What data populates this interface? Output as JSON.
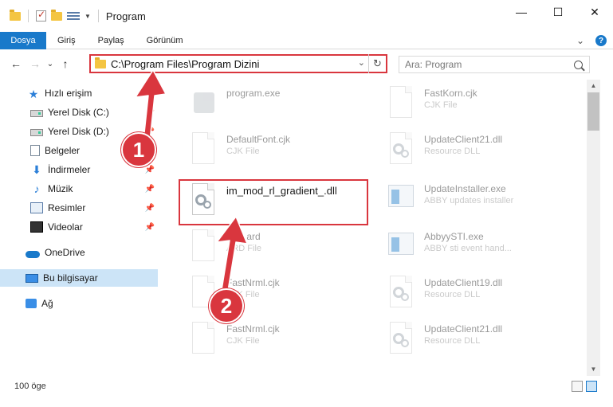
{
  "window": {
    "title": "Program",
    "minimize": "—",
    "maximize": "☐",
    "close": "✕"
  },
  "ribbon": {
    "tabs": [
      "Dosya",
      "Giriş",
      "Paylaş",
      "Görünüm"
    ],
    "expand": "⌄",
    "help": "?"
  },
  "nav": {
    "back": "←",
    "forward": "→",
    "recent": "⌄",
    "up": "↑",
    "address": "C:\\Program Files\\Program Dizini",
    "dropdown": "⌄",
    "refresh": "↻",
    "search_placeholder": "Ara: Program"
  },
  "sidebar": {
    "items": [
      {
        "label": "Hızlı erişim",
        "icon": "star-icon",
        "pinned": false
      },
      {
        "label": "Yerel Disk (C:)",
        "icon": "disk-icon",
        "pinned": true
      },
      {
        "label": "Yerel Disk (D:)",
        "icon": "disk-icon",
        "pinned": true
      },
      {
        "label": "Belgeler",
        "icon": "documents-icon",
        "pinned": true
      },
      {
        "label": "İndirmeler",
        "icon": "download-icon",
        "pinned": true
      },
      {
        "label": "Müzik",
        "icon": "music-icon",
        "pinned": true
      },
      {
        "label": "Resimler",
        "icon": "pictures-icon",
        "pinned": true
      },
      {
        "label": "Videolar",
        "icon": "videos-icon",
        "pinned": true
      },
      {
        "label": "OneDrive",
        "icon": "cloud-icon",
        "pinned": false
      },
      {
        "label": "Bu bilgisayar",
        "icon": "computer-icon",
        "pinned": false,
        "selected": true
      },
      {
        "label": "Ağ",
        "icon": "network-icon",
        "pinned": false
      }
    ],
    "pin_glyph": "📌"
  },
  "files": {
    "left": [
      {
        "name": "program.exe",
        "type": "",
        "icon": "package-icon"
      },
      {
        "name": "DefaultFont.cjk",
        "type": "CJK File",
        "icon": "document-icon"
      },
      {
        "name": "im_mod_rl_gradient_.dll",
        "type": "",
        "icon": "dll-gear-icon"
      },
      {
        "name": "fdsc.ard",
        "type": "ARD File",
        "icon": "document-icon"
      },
      {
        "name": "FastNrml.cjk",
        "type": "CJK File",
        "icon": "document-icon"
      },
      {
        "name": "FastNrml.cjk",
        "type": "CJK File",
        "icon": "document-icon"
      }
    ],
    "right": [
      {
        "name": "FastKorn.cjk",
        "type": "CJK File",
        "icon": "document-icon"
      },
      {
        "name": "UpdateClient21.dll",
        "type": "Resource DLL",
        "icon": "dll-gear-icon"
      },
      {
        "name": "UpdateInstaller.exe",
        "type": "ABBY updates installer",
        "icon": "exe-icon"
      },
      {
        "name": "AbbyySTI.exe",
        "type": "ABBY sti event hand...",
        "icon": "exe-icon"
      },
      {
        "name": "UpdateClient19.dll",
        "type": "Resource DLL",
        "icon": "dll-gear-icon"
      },
      {
        "name": "UpdateClient21.dll",
        "type": "Resource DLL",
        "icon": "dll-gear-icon"
      }
    ]
  },
  "scroll": {
    "up": "▲",
    "down": "▼"
  },
  "status": {
    "count": "100 öge"
  },
  "annotations": {
    "step1": "1",
    "step2": "2",
    "color": "#d9363e"
  }
}
